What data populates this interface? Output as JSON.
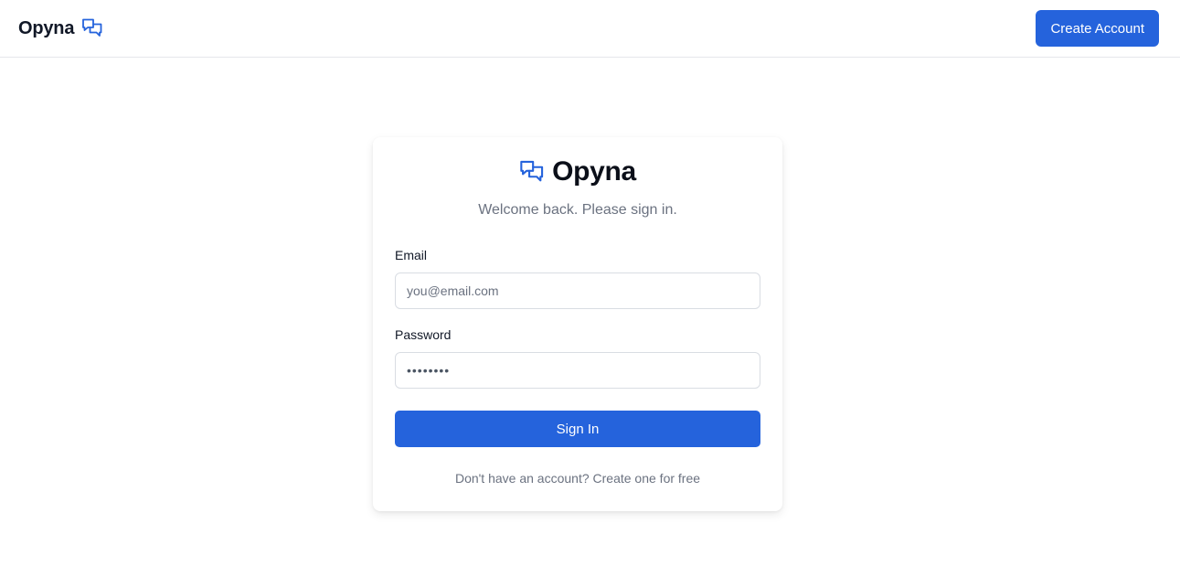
{
  "header": {
    "brand_name": "Opyna",
    "brand_icon": "chat-bubbles-icon",
    "create_account_label": "Create Account"
  },
  "card": {
    "brand_name": "Opyna",
    "brand_icon": "chat-bubbles-icon",
    "subtitle": "Welcome back. Please sign in.",
    "email_label": "Email",
    "email_placeholder": "you@email.com",
    "password_label": "Password",
    "password_value": "••••••••",
    "signin_label": "Sign In",
    "footer_prefix": "Don't have an account?",
    "footer_link": "Create one for free"
  },
  "colors": {
    "accent": "#2563dc",
    "muted_text": "#6b7280",
    "border": "#e5e7eb"
  }
}
